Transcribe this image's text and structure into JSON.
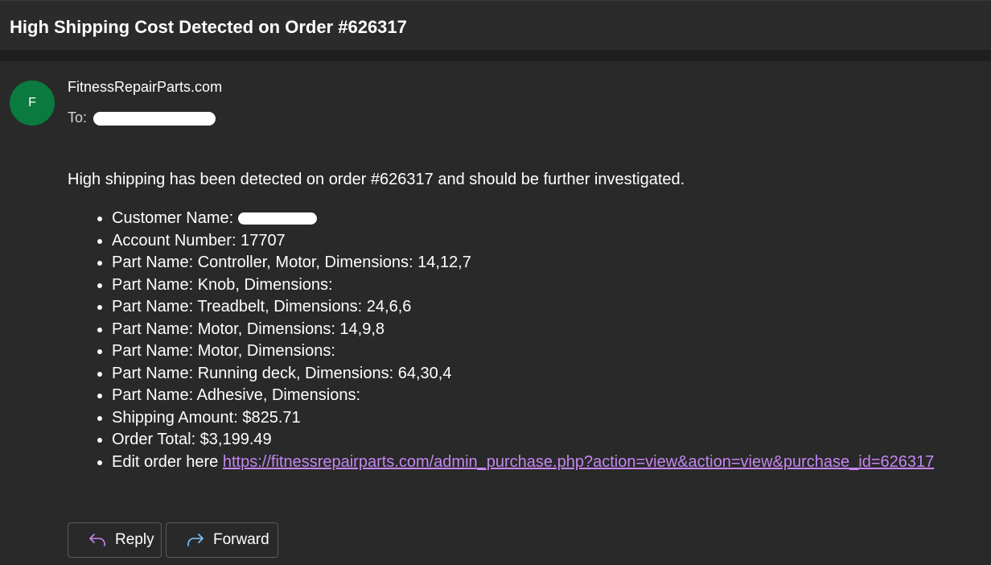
{
  "subject": "High Shipping Cost Detected on Order #626317",
  "sender": {
    "avatar_initial": "F",
    "name": "FitnessRepairParts.com",
    "to_label": "To:"
  },
  "colors": {
    "avatar": "#0a7a3e",
    "link": "#c586f0",
    "background": "#292929"
  },
  "body": {
    "intro": "High shipping has been detected on order #626317 and should be further investigated.",
    "customer_label": "Customer Name:",
    "items": [
      "Account Number: 17707",
      "Part Name: Controller, Motor, Dimensions: 14,12,7",
      "Part Name: Knob, Dimensions:",
      "Part Name: Treadbelt, Dimensions: 24,6,6",
      "Part Name: Motor, Dimensions: 14,9,8",
      "Part Name: Motor, Dimensions:",
      "Part Name: Running deck, Dimensions: 64,30,4",
      "Part Name: Adhesive, Dimensions:",
      "Shipping Amount: $825.71",
      "Order Total: $3,199.49"
    ],
    "edit_label": "Edit order here",
    "edit_link": "https://fitnessrepairparts.com/admin_purchase.php?action=view&action=view&purchase_id=626317"
  },
  "actions": {
    "reply_label": "Reply",
    "reply_icon": "reply-arrow-icon",
    "forward_label": "Forward",
    "forward_icon": "forward-arrow-icon"
  }
}
